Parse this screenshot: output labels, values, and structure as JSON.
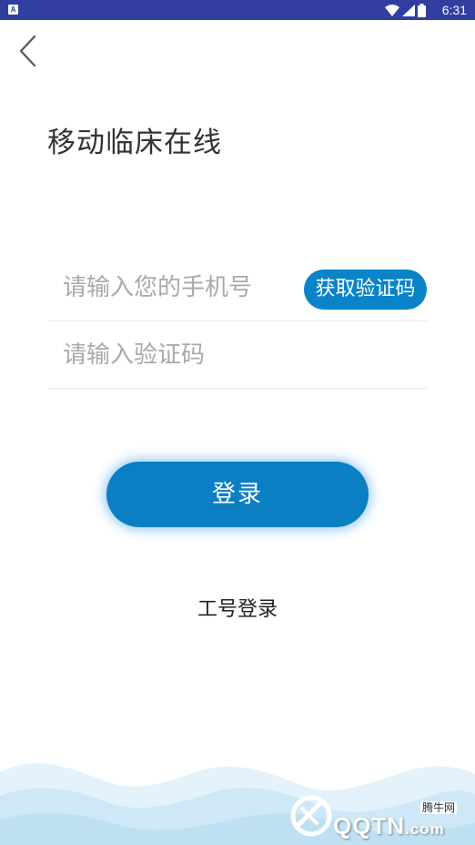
{
  "status_bar": {
    "app_badge": "A",
    "time": "6:31",
    "background": "#303f9f",
    "icons": [
      "wifi-icon",
      "signal-icon",
      "battery-icon"
    ]
  },
  "header": {
    "back_icon": "chevron-left-icon"
  },
  "title": "移动临床在线",
  "form": {
    "phone_placeholder": "请输入您的手机号",
    "phone_value": "",
    "get_code_label": "获取验证码",
    "code_placeholder": "请输入验证码",
    "code_value": ""
  },
  "login_button_label": "登录",
  "staff_login_label": "工号登录",
  "watermark": {
    "brand": "QQTN",
    "tld": ".com",
    "cn_label": "腾牛网"
  },
  "colors": {
    "accent": "#0a84c8",
    "title_text": "#333333",
    "placeholder": "#a9a9a9",
    "wave": "#d6ecf8"
  }
}
